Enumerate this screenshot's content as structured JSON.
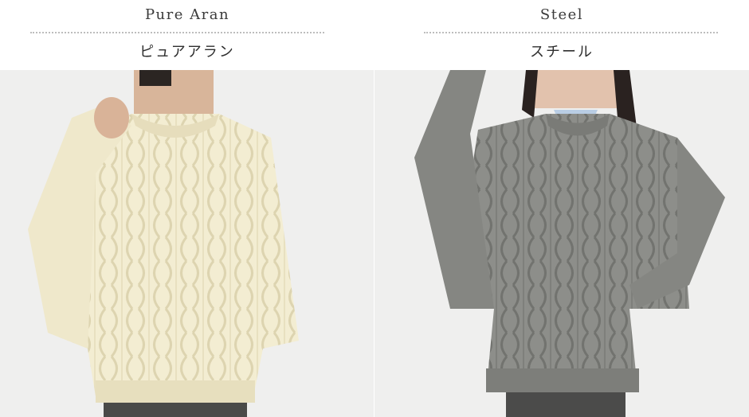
{
  "products": [
    {
      "name_en": "Pure Aran",
      "name_jp": "ピュアアラン",
      "sweater_color": "#f3edd2",
      "image_alt": "pure-aran-sweater-photo"
    },
    {
      "name_en": "Steel",
      "name_jp": "スチール",
      "sweater_color": "#8d8e8a",
      "image_alt": "steel-sweater-photo"
    }
  ],
  "colors": {
    "background": "#ffffff",
    "photo_bg": "#f0f0ef",
    "divider": "#bdbdbd",
    "text": "#333333"
  }
}
